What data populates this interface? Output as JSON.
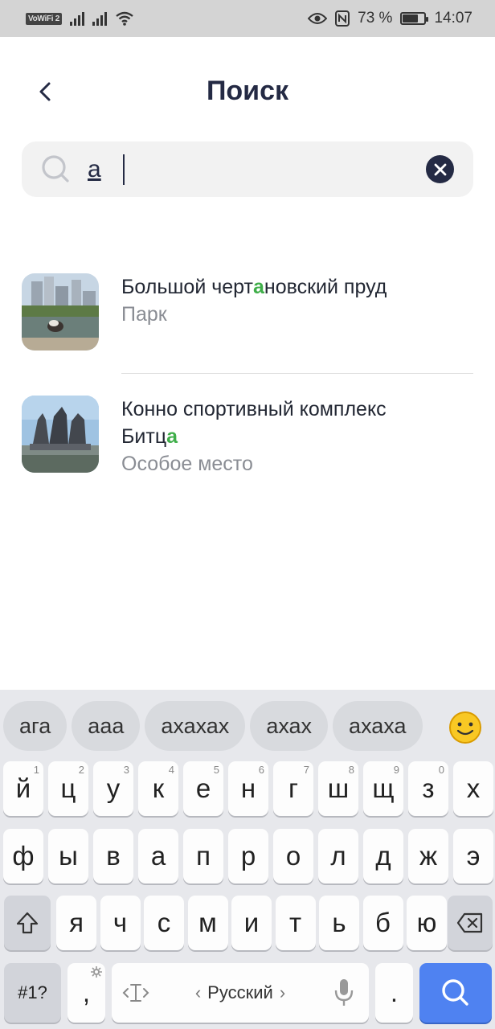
{
  "status_bar": {
    "vowifi": "VoWiFi",
    "vowifi_sub": "2",
    "battery_text": "73 %",
    "battery_fraction": 0.73,
    "time": "14:07"
  },
  "header": {
    "title": "Поиск"
  },
  "search": {
    "value": "а"
  },
  "results": [
    {
      "title_pre": "Большой черт",
      "title_hl": "а",
      "title_post": "новский пруд",
      "subtitle": "Парк"
    },
    {
      "title_pre": "Конно спортивный комплекс",
      "title_line2_pre": "Битц",
      "title_hl": "а",
      "subtitle": "Особое место"
    }
  ],
  "keyboard": {
    "suggestions": [
      "ага",
      "ааа",
      "ахахах",
      "ахах",
      "ахаха"
    ],
    "row1": [
      {
        "k": "й",
        "n": "1"
      },
      {
        "k": "ц",
        "n": "2"
      },
      {
        "k": "у",
        "n": "3"
      },
      {
        "k": "к",
        "n": "4"
      },
      {
        "k": "е",
        "n": "5"
      },
      {
        "k": "н",
        "n": "6"
      },
      {
        "k": "г",
        "n": "7"
      },
      {
        "k": "ш",
        "n": "8"
      },
      {
        "k": "щ",
        "n": "9"
      },
      {
        "k": "з",
        "n": "0"
      },
      {
        "k": "х",
        "n": ""
      }
    ],
    "row2": [
      "ф",
      "ы",
      "в",
      "а",
      "п",
      "р",
      "о",
      "л",
      "д",
      "ж",
      "э"
    ],
    "row3": [
      "я",
      "ч",
      "с",
      "м",
      "и",
      "т",
      "ь",
      "б",
      "ю"
    ],
    "symbols_label": "#1?",
    "comma_label": ",",
    "language_label": "Русский",
    "period_label": "."
  }
}
